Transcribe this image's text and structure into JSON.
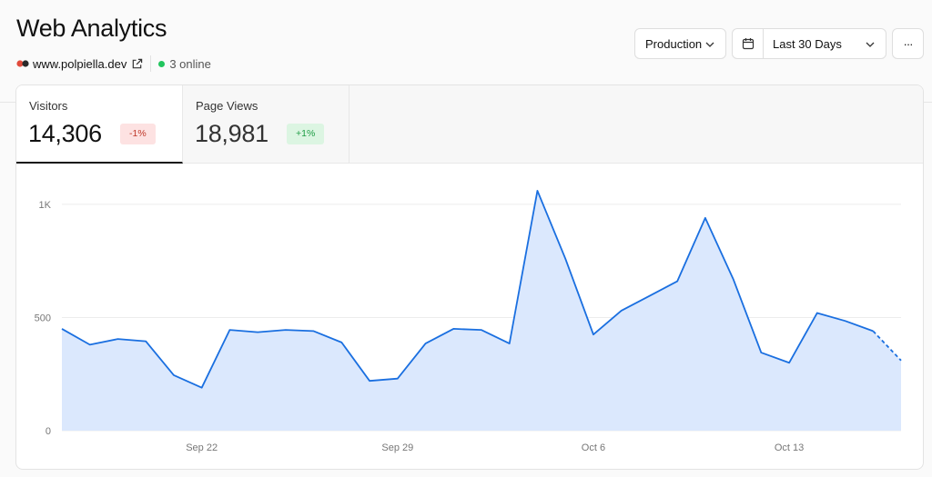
{
  "header": {
    "title": "Web Analytics",
    "domain": "www.polpiella.dev",
    "online": "3 online"
  },
  "controls": {
    "environment": "Production",
    "range": "Last 30 Days",
    "more": "···"
  },
  "colors": {
    "accent": "#1a6fe0",
    "fill": "#dbe8fd",
    "online_dot": "#22c55e",
    "negative_badge": "#fde2e2",
    "positive_badge": "#dcf5e2"
  },
  "tabs": [
    {
      "label": "Visitors",
      "value": "14,306",
      "delta": "-1%",
      "selected": true
    },
    {
      "label": "Page Views",
      "value": "18,981",
      "delta": "+1%",
      "selected": false
    }
  ],
  "chart_data": {
    "type": "area",
    "x": [
      "Sep 17",
      "Sep 18",
      "Sep 19",
      "Sep 20",
      "Sep 21",
      "Sep 22",
      "Sep 23",
      "Sep 24",
      "Sep 25",
      "Sep 26",
      "Sep 27",
      "Sep 28",
      "Sep 29",
      "Sep 30",
      "Oct 1",
      "Oct 2",
      "Oct 3",
      "Oct 4",
      "Oct 5",
      "Oct 6",
      "Oct 7",
      "Oct 8",
      "Oct 9",
      "Oct 10",
      "Oct 11",
      "Oct 12",
      "Oct 13",
      "Oct 14",
      "Oct 15",
      "Oct 16",
      "Oct 17"
    ],
    "values": [
      450,
      380,
      405,
      395,
      245,
      190,
      445,
      435,
      445,
      440,
      390,
      220,
      230,
      385,
      450,
      445,
      385,
      1060,
      760,
      425,
      530,
      595,
      660,
      940,
      670,
      345,
      300,
      520,
      485,
      440,
      310
    ],
    "partial_last": true,
    "yticks": [
      0,
      500,
      1000
    ],
    "ytick_labels": [
      "0",
      "500",
      "1K"
    ],
    "xtick_labels": [
      "Sep 22",
      "Sep 29",
      "Oct 6",
      "Oct 13"
    ],
    "xtick_positions": [
      "Sep 22",
      "Sep 29",
      "Oct 6",
      "Oct 13"
    ],
    "ylim": [
      0,
      1100
    ],
    "grid": true
  }
}
